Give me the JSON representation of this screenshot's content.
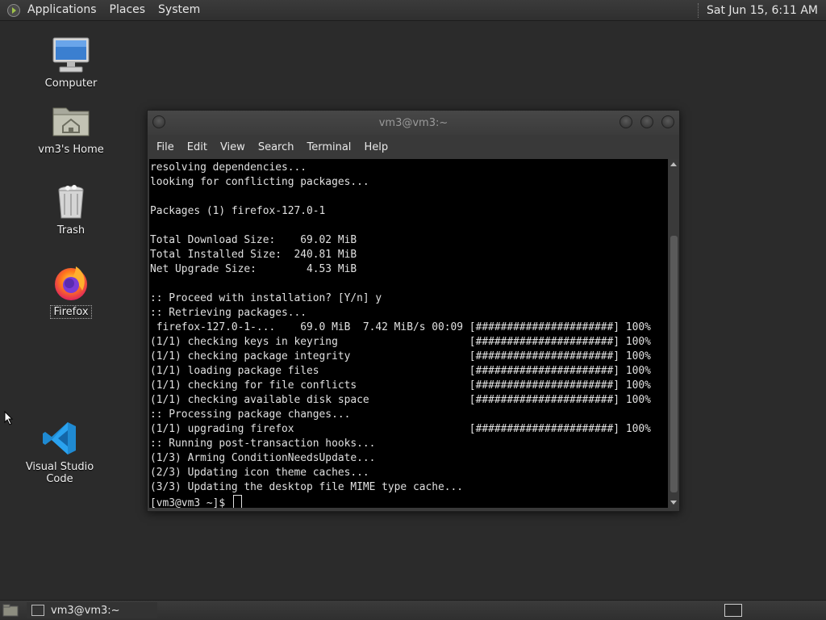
{
  "top_panel": {
    "menus": [
      "Applications",
      "Places",
      "System"
    ],
    "clock": "Sat Jun 15,  6:11 AM"
  },
  "desktop": {
    "icons": [
      {
        "label": "Computer",
        "icon": "computer-icon"
      },
      {
        "label": "vm3's Home",
        "icon": "home-folder-icon"
      },
      {
        "label": "Trash",
        "icon": "trash-icon"
      },
      {
        "label": "Firefox",
        "icon": "firefox-icon"
      },
      {
        "label": "Visual Studio Code",
        "icon": "vscode-icon"
      }
    ]
  },
  "terminal": {
    "title": "vm3@vm3:~",
    "menu": [
      "File",
      "Edit",
      "View",
      "Search",
      "Terminal",
      "Help"
    ],
    "lines": [
      "resolving dependencies...",
      "looking for conflicting packages...",
      "",
      "Packages (1) firefox-127.0-1",
      "",
      "Total Download Size:    69.02 MiB",
      "Total Installed Size:  240.81 MiB",
      "Net Upgrade Size:        4.53 MiB",
      "",
      ":: Proceed with installation? [Y/n] y",
      ":: Retrieving packages...",
      " firefox-127.0-1-...    69.0 MiB  7.42 MiB/s 00:09 [######################] 100%",
      "(1/1) checking keys in keyring                     [######################] 100%",
      "(1/1) checking package integrity                   [######################] 100%",
      "(1/1) loading package files                        [######################] 100%",
      "(1/1) checking for file conflicts                  [######################] 100%",
      "(1/1) checking available disk space                [######################] 100%",
      ":: Processing package changes...",
      "(1/1) upgrading firefox                            [######################] 100%",
      ":: Running post-transaction hooks...",
      "(1/3) Arming ConditionNeedsUpdate...",
      "(2/3) Updating icon theme caches...",
      "(3/3) Updating the desktop file MIME type cache..."
    ],
    "prompt": "[vm3@vm3 ~]$ "
  },
  "bottom_panel": {
    "task_label": "vm3@vm3:~"
  }
}
